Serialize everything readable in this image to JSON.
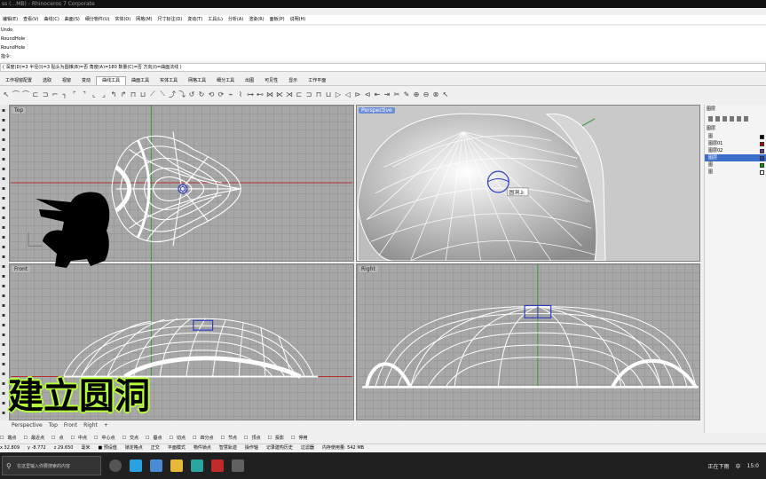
{
  "window": {
    "title": "ss   (...MB) - Rhinoceros 7 Corporate"
  },
  "menu": [
    "编辑(E)",
    "查看(V)",
    "曲线(C)",
    "曲面(S)",
    "细分物件(U)",
    "实体(O)",
    "网格(M)",
    "尺寸标注(D)",
    "变动(T)",
    "工具(L)",
    "分析(A)",
    "渲染(R)",
    "面板(P)",
    "说明(H)"
  ],
  "history": [
    "Undo",
    "RoundHole",
    "RoundHole",
    "指令:"
  ],
  "command_prompt": "( 深度(D)=3  半径(I)=3  贴头为圆锥(B)=否  角度(A)=180  数量(C)=否  方向(I)=曲面法线 )",
  "toolbar_tabs": [
    "标准",
    "工作平面",
    "设置视图",
    "显示",
    "选取",
    "工作视窗配置",
    "可见性",
    "变动",
    "曲线工具",
    "曲面工具",
    "实体工具",
    "网格工具",
    "渲染工具",
    "出图",
    "5 新功能"
  ],
  "toolbar_tabs_visible": [
    "工作视窗配置",
    "选取",
    "视窗",
    "变动",
    "曲线工具",
    "曲面工具",
    "实体工具",
    "网格工具",
    "细分工具",
    "出图",
    "可见性",
    "显示",
    "工作平面"
  ],
  "active_tab": "曲线工具",
  "viewports": [
    {
      "name": "Top",
      "active": false
    },
    {
      "name": "Perspective",
      "active": true
    },
    {
      "name": "Front",
      "active": false
    },
    {
      "name": "Right",
      "active": false
    }
  ],
  "persp_tooltip": "圆洞上",
  "panel": {
    "title": "图层",
    "subtitle": "图层",
    "layers": [
      {
        "name": "图",
        "color": "#000000",
        "selected": false
      },
      {
        "name": "图层01",
        "color": "#c00000",
        "selected": false
      },
      {
        "name": "图层02",
        "color": "#7030a0",
        "selected": false
      },
      {
        "name": "图层",
        "color": "#1f3fbf",
        "selected": true
      },
      {
        "name": "图",
        "color": "#00a000",
        "selected": false
      },
      {
        "name": "图",
        "color": "#ffffff",
        "selected": false
      }
    ]
  },
  "viewport_tabs": [
    "Perspective",
    "Top",
    "Front",
    "Right",
    "+"
  ],
  "osnaps": [
    "端点",
    "最近点",
    "点",
    "中点",
    "中心点",
    "交点",
    "垂点",
    "切点",
    "四分点",
    "节点",
    "顶点",
    "投影",
    "停用"
  ],
  "status_items": [
    "x 32.809",
    "y -8.772",
    "z 29.650",
    "毫米",
    "■ 预设值",
    "锁定格点",
    "正交",
    "平面模式",
    "物件锁点",
    "智慧轨迹",
    "操作轴",
    "记录建构历史",
    "过滤器",
    "内存使用量: 542 MB"
  ],
  "taskbar": {
    "search_placeholder": "在这里输入你要搜索的内容",
    "tray_text": "正在下雨",
    "clock": "15:0",
    "ime": "中"
  },
  "overlay_text": "建立圆洞"
}
